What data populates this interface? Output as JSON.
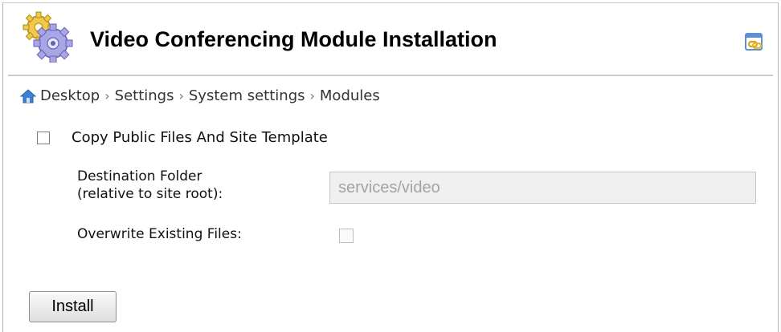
{
  "header": {
    "title": "Video Conferencing Module Installation",
    "icon": "gears-icon",
    "link_icon": "chain-link-icon"
  },
  "breadcrumb": {
    "home_icon": "home-icon",
    "separator": "›",
    "items": [
      "Desktop",
      "Settings",
      "System settings",
      "Modules"
    ]
  },
  "form": {
    "copy_files_label": "Copy Public Files And Site Template",
    "copy_files_checked": false,
    "destination_label_line1": "Destination Folder",
    "destination_label_line2": "(relative to site root):",
    "destination_value": "services/video",
    "overwrite_label": "Overwrite Existing Files:",
    "overwrite_checked": false
  },
  "install_button": "Install",
  "colors": {
    "divider": "#cccccc",
    "input_bg": "#f0f0f0",
    "input_text": "#a3a3a3",
    "home_icon_blue": "#3d7fd4"
  }
}
